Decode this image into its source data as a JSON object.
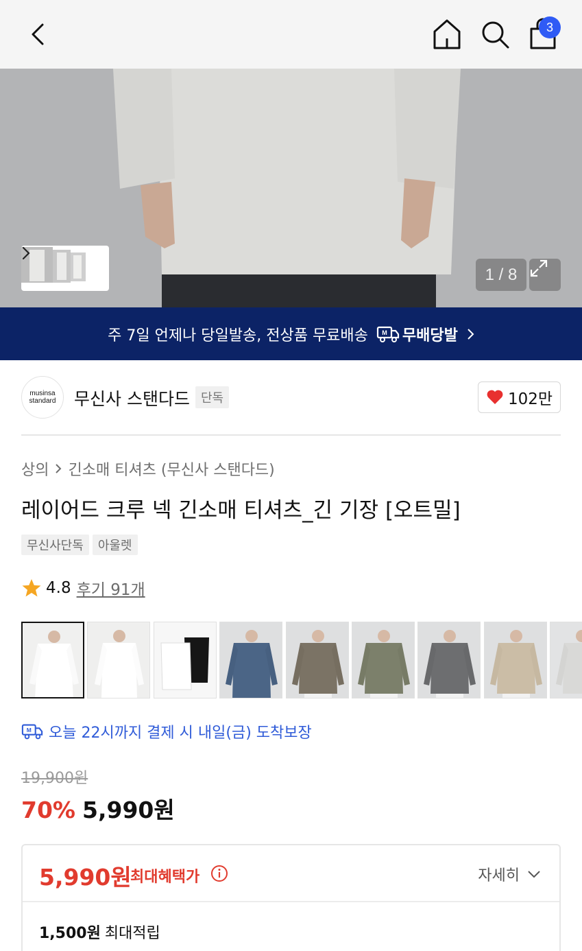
{
  "nav": {
    "back_icon": "chevron-left-icon",
    "home_icon": "home-icon",
    "search_icon": "search-icon",
    "cart_icon": "shopping-bag-icon",
    "cart_count": "3"
  },
  "gallery": {
    "counter": "1 / 8",
    "current": 1,
    "total": 8
  },
  "banner": {
    "text": "주 7일 언제나 당일발송, 전상품 무료배송",
    "service": "무배당발"
  },
  "brand": {
    "logo_line1": "musinsa",
    "logo_line2": "standard",
    "name": "무신사 스탠다드",
    "badge": "단독",
    "likes": "102만"
  },
  "product": {
    "breadcrumb": [
      "상의",
      "긴소매 티셔츠 (무신사 스탠다드)"
    ],
    "title": "레이어드 크루 넥 긴소매 티셔츠_긴 기장 [오트밀]",
    "tags": [
      "무신사단독",
      "아울렛"
    ],
    "rating": "4.8",
    "reviews": "후기 91개"
  },
  "swatches": [
    {
      "color": "#ededeb",
      "label": "oatmeal"
    },
    {
      "color": "#f6f6f4",
      "label": "white"
    },
    {
      "color": "#f4f4f4",
      "label": "white-black"
    },
    {
      "color": "#4b6586",
      "label": "navy"
    },
    {
      "color": "#7b7365",
      "label": "brown"
    },
    {
      "color": "#7c806b",
      "label": "khaki"
    },
    {
      "color": "#6d6e70",
      "label": "gray"
    },
    {
      "color": "#cbbda6",
      "label": "beige"
    },
    {
      "color": "#d9d9d7",
      "label": "light gray"
    }
  ],
  "delivery": {
    "text": "오늘 22시까지 결제 시 내일(금) 도착보장"
  },
  "price": {
    "original": "19,900원",
    "discount": "70%",
    "sale": "5,990원"
  },
  "benefit": {
    "price": "5,990원",
    "label": "최대혜택가",
    "detail": "자세히",
    "points_amount": "1,500원",
    "points_label": "최대적립"
  },
  "colors": {
    "accent_blue": "#2f5bf5",
    "banner_navy": "#0c2366",
    "sale_red": "#e13b2e",
    "heart_red": "#e8302f",
    "star_orange": "#f5a623"
  }
}
